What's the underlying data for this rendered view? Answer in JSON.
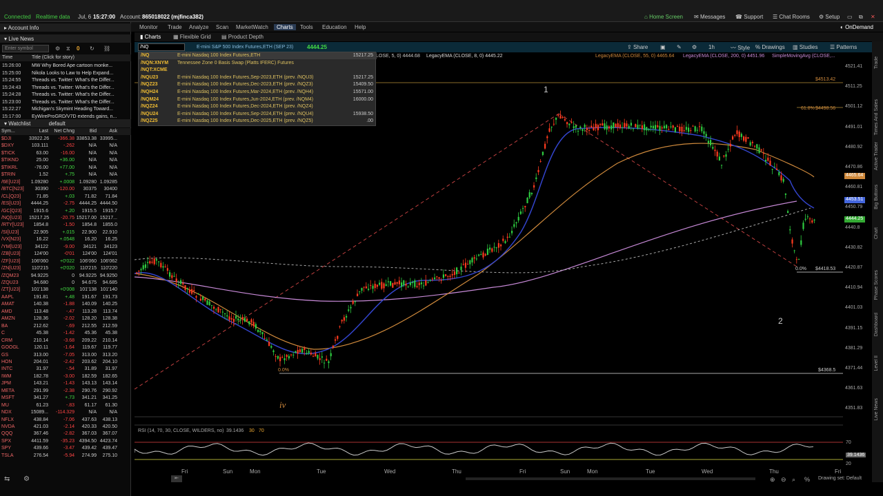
{
  "status": {
    "connected": "Connected",
    "realtime": "Realtime data",
    "date": "Jul, 6",
    "time": "15:27:00",
    "account_label": "Account:",
    "account": "865018022 (mjfinca382)"
  },
  "menu": [
    "Monitor",
    "Trade",
    "Analyze",
    "Scan",
    "MarketWatch",
    "Charts",
    "Tools",
    "Education",
    "Help"
  ],
  "menu_active": "Charts",
  "right_links": [
    "Home Screen",
    "Messages",
    "Support",
    "Chat Rooms",
    "Setup"
  ],
  "ondemand": "OnDemand",
  "left": {
    "account_info": "Account Info",
    "live_news": "Live News",
    "symbol_placeholder": "Enter symbol",
    "news_count": "0",
    "news_headers": [
      "Time",
      "Title (Click for story)"
    ],
    "news": [
      [
        "15:26:00",
        "MW Why Bored Ape cartoon monke..."
      ],
      [
        "15:25:00",
        "Nikola Looks to Law to Help Expand..."
      ],
      [
        "15:24:55",
        "Threads vs. Twitter: What's the Differ..."
      ],
      [
        "15:24:43",
        "Threads vs. Twitter: What's the Differ..."
      ],
      [
        "15:24:28",
        "Threads vs. Twitter: What's the Differ..."
      ],
      [
        "15:23:00",
        "Threads vs. Twitter: What's the Differ..."
      ],
      [
        "15:22:27",
        "Michigan's Skymint Heading Toward..."
      ],
      [
        "15:17:00",
        "EyWireProGRD/V7D extends gains, n..."
      ]
    ],
    "watchlist": "Watchlist",
    "watchlist_name": "default",
    "wl_headers": [
      "Sym...",
      "Last",
      "Net Chng",
      "Bid",
      "Ask"
    ],
    "rows": [
      [
        "$DJI",
        "33922.26",
        "-366.38",
        "33853.38",
        "33995..."
      ],
      [
        "$DXY",
        "103.111",
        "-.262",
        "N/A",
        "N/A"
      ],
      [
        "$TICK",
        "63.00",
        "-16.00",
        "N/A",
        "N/A"
      ],
      [
        "$TIKND",
        "25.00",
        "+36.00",
        "N/A",
        "N/A"
      ],
      [
        "$TIKRL",
        "-76.00",
        "+77.00",
        "N/A",
        "N/A"
      ],
      [
        "$TRIN",
        "1.52",
        "+.75",
        "N/A",
        "N/A"
      ],
      [
        "/6E[U23]",
        "1.09280",
        "+.0008",
        "1.09280",
        "1.09285"
      ],
      [
        "/BTC[N23]",
        "30390",
        "-120.00",
        "30375",
        "30400"
      ],
      [
        "/CL[Q23]",
        "71.85",
        "+.03",
        "71.82",
        "71.84"
      ],
      [
        "/ES[U23]",
        "4444.25",
        "-2.75",
        "4444.25",
        "4444.50"
      ],
      [
        "/GC[Q23]",
        "1915.6",
        "+.20",
        "1915.5",
        "1915.7"
      ],
      [
        "/NQ[U23]",
        "15217.25",
        "-20.75",
        "15217.00",
        "15217..."
      ],
      [
        "/RTY[U23]",
        "1854.8",
        "-1.50",
        "1854.8",
        "1855.0"
      ],
      [
        "/SI[U23]",
        "22.905",
        "+.015",
        "22.900",
        "22.910"
      ],
      [
        "/VX[N23]",
        "16.22",
        "+.0548",
        "16.20",
        "16.25"
      ],
      [
        "/YM[U23]",
        "34122",
        "-9.00",
        "34121",
        "34123"
      ],
      [
        "/ZB[U23]",
        "124'00",
        "-0'01",
        "124'00",
        "124'01"
      ],
      [
        "/ZF[U23]",
        "106'060",
        "+0'022",
        "106'060",
        "106'062"
      ],
      [
        "/ZN[U23]",
        "110'215",
        "+0'020",
        "110'215",
        "110'220"
      ],
      [
        "/ZQM23",
        "94.9225",
        "0",
        "94.9225",
        "94.9250"
      ],
      [
        "/ZQU23",
        "94.680",
        "0",
        "94.675",
        "94.685"
      ],
      [
        "/ZT[U23]",
        "101'138",
        "+0'008",
        "101'138",
        "101'140"
      ],
      [
        "AAPL",
        "191.81",
        "+.48",
        "191.67",
        "191.73"
      ],
      [
        "AMAT",
        "140.38",
        "-1.88",
        "140.09",
        "140.25"
      ],
      [
        "AMD",
        "113.48",
        "-.47",
        "113.28",
        "113.74"
      ],
      [
        "AMZN",
        "128.36",
        "-2.02",
        "128.20",
        "128.38"
      ],
      [
        "BA",
        "212.62",
        "-.69",
        "212.55",
        "212.59"
      ],
      [
        "C",
        "45.38",
        "-1.42",
        "45.36",
        "45.38"
      ],
      [
        "CRM",
        "210.14",
        "-3.68",
        "209.22",
        "210.14"
      ],
      [
        "GOOGL",
        "120.11",
        "-1.64",
        "119.67",
        "119.77"
      ],
      [
        "GS",
        "313.00",
        "-7.05",
        "313.00",
        "313.20"
      ],
      [
        "HON",
        "204.01",
        "-2.42",
        "203.62",
        "204.10"
      ],
      [
        "INTC",
        "31.97",
        "-.54",
        "31.89",
        "31.97"
      ],
      [
        "IWM",
        "182.78",
        "-3.00",
        "182.59",
        "182.65"
      ],
      [
        "JPM",
        "143.21",
        "-1.43",
        "143.13",
        "143.14"
      ],
      [
        "META",
        "291.99",
        "-2.38",
        "290.76",
        "290.92"
      ],
      [
        "MSFT",
        "341.27",
        "+.73",
        "341.21",
        "341.25"
      ],
      [
        "MU",
        "61.23",
        "-.83",
        "61.17",
        "61.30"
      ],
      [
        "NDX",
        "15089...",
        "-114.329",
        "N/A",
        "N/A"
      ],
      [
        "NFLX",
        "438.84",
        "-7.06",
        "437.63",
        "438.13"
      ],
      [
        "NVDA",
        "421.03",
        "-2.14",
        "420.33",
        "420.50"
      ],
      [
        "QQQ",
        "367.46",
        "-2.82",
        "367.03",
        "367.07"
      ],
      [
        "SPX",
        "4411.59",
        "-35.23",
        "4394.50",
        "4423.74"
      ],
      [
        "SPY",
        "439.66",
        "-3.47",
        "439.42",
        "439.47"
      ],
      [
        "TSLA",
        "276.54",
        "-5.94",
        "274.99",
        "275.10"
      ]
    ]
  },
  "chart": {
    "tabs": [
      "Charts",
      "Flexible Grid",
      "Product Depth"
    ],
    "symbol_input": "/NQ",
    "instrument": "E-mini S&P 500 Index Futures,ETH (SEP 23)",
    "price": "4444.25",
    "toolbar": [
      "Share",
      "1h",
      "Style",
      "Drawings",
      "Studies",
      "Patterns"
    ],
    "studies": [
      [
        "LOSE, 5, 0)",
        "4444.68"
      ],
      [
        "LegacyEMA (CLOSE, 8, 0)",
        "4445.22"
      ],
      [
        "LegacyEMA (CLOSE, 55, 0)",
        "4465.64"
      ],
      [
        "LegacyEMA (CLOSE, 200, 0)",
        "4451.96"
      ],
      [
        "SimpleMovingAvg (CLOSE,...",
        ""
      ]
    ],
    "dropdown": [
      [
        "/NQ",
        "E-mini Nasdaq 100 Index Futures,ETH",
        "15217.25"
      ],
      [
        "/NQN:XNYM",
        "Tennessee Zone 0 Basis Swap (Platts IFERC) Futures",
        ""
      ],
      [
        "/NQT:XCME",
        "",
        ""
      ],
      [
        "/NQU23",
        "E-mini Nasdaq 100 Index Futures,Sep-2023,ETH (prev. /NQU3)",
        "15217.25"
      ],
      [
        "/NQZ23",
        "E-mini Nasdaq 100 Index Futures,Dec-2023,ETH (prev. /NQZ3)",
        "15409.50"
      ],
      [
        "/NQH24",
        "E-mini Nasdaq 100 Index Futures,Mar-2024,ETH (prev. /NQH4)",
        "15571.00"
      ],
      [
        "/NQM24",
        "E-mini Nasdaq 100 Index Futures,Jun-2024,ETH (prev. /NQM4)",
        "16000.00"
      ],
      [
        "/NQZ24",
        "E-mini Nasdaq 100 Index Futures,Dec-2024,ETH (prev. /NQZ4)",
        ""
      ],
      [
        "/NQU24",
        "E-mini Nasdaq 100 Index Futures,Sep-2024,ETH (prev. /NQU4)",
        "15938.50"
      ],
      [
        "/NQZ25",
        "E-mini Nasdaq 100 Index Futures,Dec-2025,ETH (prev. /NQZ5)",
        ".00"
      ]
    ],
    "annotations": {
      "wave1": "1",
      "wave2": "2",
      "waveiv": "iv",
      "fib618": "61.8%",
      "fib0a": "0.0%",
      "fib0b": "0.0%"
    },
    "price_labels": [
      "$4513.42",
      "$4498.56",
      "$4418.53",
      "$4368.5"
    ],
    "y_ticks": [
      "4521.41",
      "4511.25",
      "4501.12",
      "4491.01",
      "4480.92",
      "4470.86",
      "4460.81",
      "4450.79",
      "4440.8",
      "4430.82",
      "4420.87",
      "4410.94",
      "4401.03",
      "4391.15",
      "4381.29",
      "4371.44",
      "4361.63",
      "4351.83"
    ],
    "badges": [
      [
        "4465.64",
        "#d08a3c"
      ],
      [
        "4453.51",
        "#4466dd"
      ],
      [
        "4444.25",
        "#33aa33"
      ]
    ],
    "x_ticks": [
      "Fri",
      "Sun",
      "Mon",
      "Tue",
      "Wed",
      "Thu",
      "Fri",
      "Sun",
      "Mon",
      "Tue",
      "Wed",
      "Thu",
      "Fri"
    ],
    "rsi_label": "RSI (14, 70, 30, CLOSE, WILDERS, no)",
    "rsi_value": "39.1436",
    "rsi_levels": [
      "30",
      "70"
    ],
    "rsi_axis": [
      "70",
      "39.1436",
      "20"
    ],
    "drawing_set": "Drawing set: Default"
  },
  "sidebar_labels": [
    "Trade",
    "Times And Sales",
    "Active Trader",
    "Big Buttons",
    "Chart",
    "Phase Scores",
    "Dashboard",
    "Level II",
    "Live News"
  ]
}
